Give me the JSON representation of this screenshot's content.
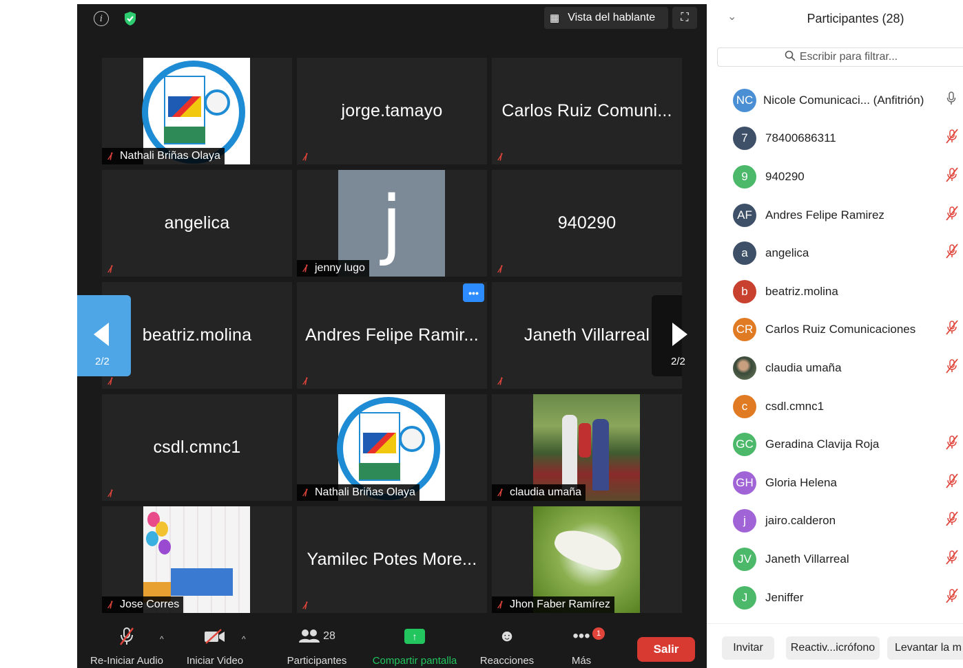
{
  "meeting": {
    "speaker_view_label": "Vista del hablante",
    "page_indicator_left": "2/2",
    "page_indicator_right": "2/2",
    "tiles": [
      {
        "name": "Nathali Briñas Olaya",
        "kind": "logo",
        "label": "Nathali Briñas Olaya"
      },
      {
        "name": "jorge.tamayo",
        "kind": "text"
      },
      {
        "name": "Carlos Ruiz Comuni...",
        "kind": "text"
      },
      {
        "name": "angelica",
        "kind": "text"
      },
      {
        "name": "jenny lugo",
        "kind": "initial",
        "initial": "j",
        "label": "jenny lugo"
      },
      {
        "name": "940290",
        "kind": "text"
      },
      {
        "name": "beatriz.molina",
        "kind": "text"
      },
      {
        "name": "Andres Felipe Ramir...",
        "kind": "text"
      },
      {
        "name": "Janeth Villarreal",
        "kind": "text"
      },
      {
        "name": "csdl.cmnc1",
        "kind": "text"
      },
      {
        "name": "Nathali Briñas Olaya",
        "kind": "logo",
        "label": "Nathali Briñas Olaya"
      },
      {
        "name": "claudia umaña",
        "kind": "photo",
        "label": "claudia umaña"
      },
      {
        "name": "Jose Corres",
        "kind": "photo",
        "label": "Jose Corres"
      },
      {
        "name": "Yamilec Potes More...",
        "kind": "text"
      },
      {
        "name": "Jhon Faber Ramírez",
        "kind": "photo",
        "label": "Jhon Faber Ramírez"
      }
    ]
  },
  "toolbar": {
    "audio_label": "Re-Iniciar Audio",
    "video_label": "Iniciar Video",
    "participants_label": "Participantes",
    "participants_count": "28",
    "share_label": "Compartir pantalla",
    "reactions_label": "Reacciones",
    "more_label": "Más",
    "more_badge": "1",
    "leave_label": "Salir"
  },
  "panel": {
    "title": "Participantes (28)",
    "search_placeholder": "Escribir para filtrar...",
    "participants": [
      {
        "initials": "NC",
        "name": "Nicole Comunicaci...  (Anfitrión)",
        "color": "#4a8fd4",
        "muted": false,
        "host": true
      },
      {
        "initials": "7",
        "name": "78400686311",
        "color": "#3d5068",
        "muted": true
      },
      {
        "initials": "9",
        "name": "940290",
        "color": "#4cb86a",
        "muted": true
      },
      {
        "initials": "AF",
        "name": "Andres Felipe Ramirez",
        "color": "#3d5068",
        "muted": true
      },
      {
        "initials": "a",
        "name": "angelica",
        "color": "#3d5068",
        "muted": true
      },
      {
        "initials": "b",
        "name": "beatriz.molina",
        "color": "#c8412e",
        "muted": false
      },
      {
        "initials": "CR",
        "name": "Carlos Ruiz Comunicaciones",
        "color": "#e07b24",
        "muted": true
      },
      {
        "initials": "",
        "name": "claudia umaña",
        "color": "#5a6a4a",
        "muted": true,
        "photo": true
      },
      {
        "initials": "c",
        "name": "csdl.cmnc1",
        "color": "#e07b24",
        "muted": false
      },
      {
        "initials": "GC",
        "name": "Geradina Clavija Roja",
        "color": "#4cb86a",
        "muted": true
      },
      {
        "initials": "GH",
        "name": "Gloria Helena",
        "color": "#a064d6",
        "muted": true
      },
      {
        "initials": "j",
        "name": "jairo.calderon",
        "color": "#a064d6",
        "muted": true
      },
      {
        "initials": "JV",
        "name": "Janeth Villarreal",
        "color": "#4cb86a",
        "muted": true
      },
      {
        "initials": "J",
        "name": "Jeniffer",
        "color": "#4cb86a",
        "muted": true
      }
    ],
    "footer": {
      "invite": "Invitar",
      "reactivate": "Reactiv...icrófono",
      "raise_hand": "Levantar la m"
    }
  }
}
